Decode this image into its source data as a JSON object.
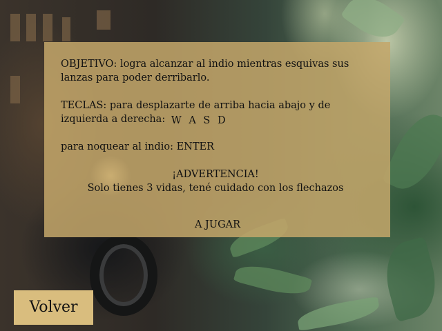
{
  "scene": {
    "background": "blurred-jungle-and-city-street"
  },
  "instructions": {
    "objective": "OBJETIVO: logra alcanzar al indio mientras esquivas sus lanzas para poder derribarlo.",
    "keys_label": "TECLAS:  para desplazarte de arriba hacia abajo y de",
    "keys_label_2": "izquierda a derecha:",
    "keys_value": "W A S D",
    "knockout": "para noquear al indio: ENTER",
    "warning_title": "¡ADVERTENCIA!",
    "warning_text": "Solo tienes 3 vidas, tené cuidado con los flechazos",
    "play_label": "A JUGAR"
  },
  "nav": {
    "back_label": "Volver"
  },
  "colors": {
    "panel": "#c4a66a",
    "back_button": "#d9bd7e",
    "text": "#111111"
  }
}
